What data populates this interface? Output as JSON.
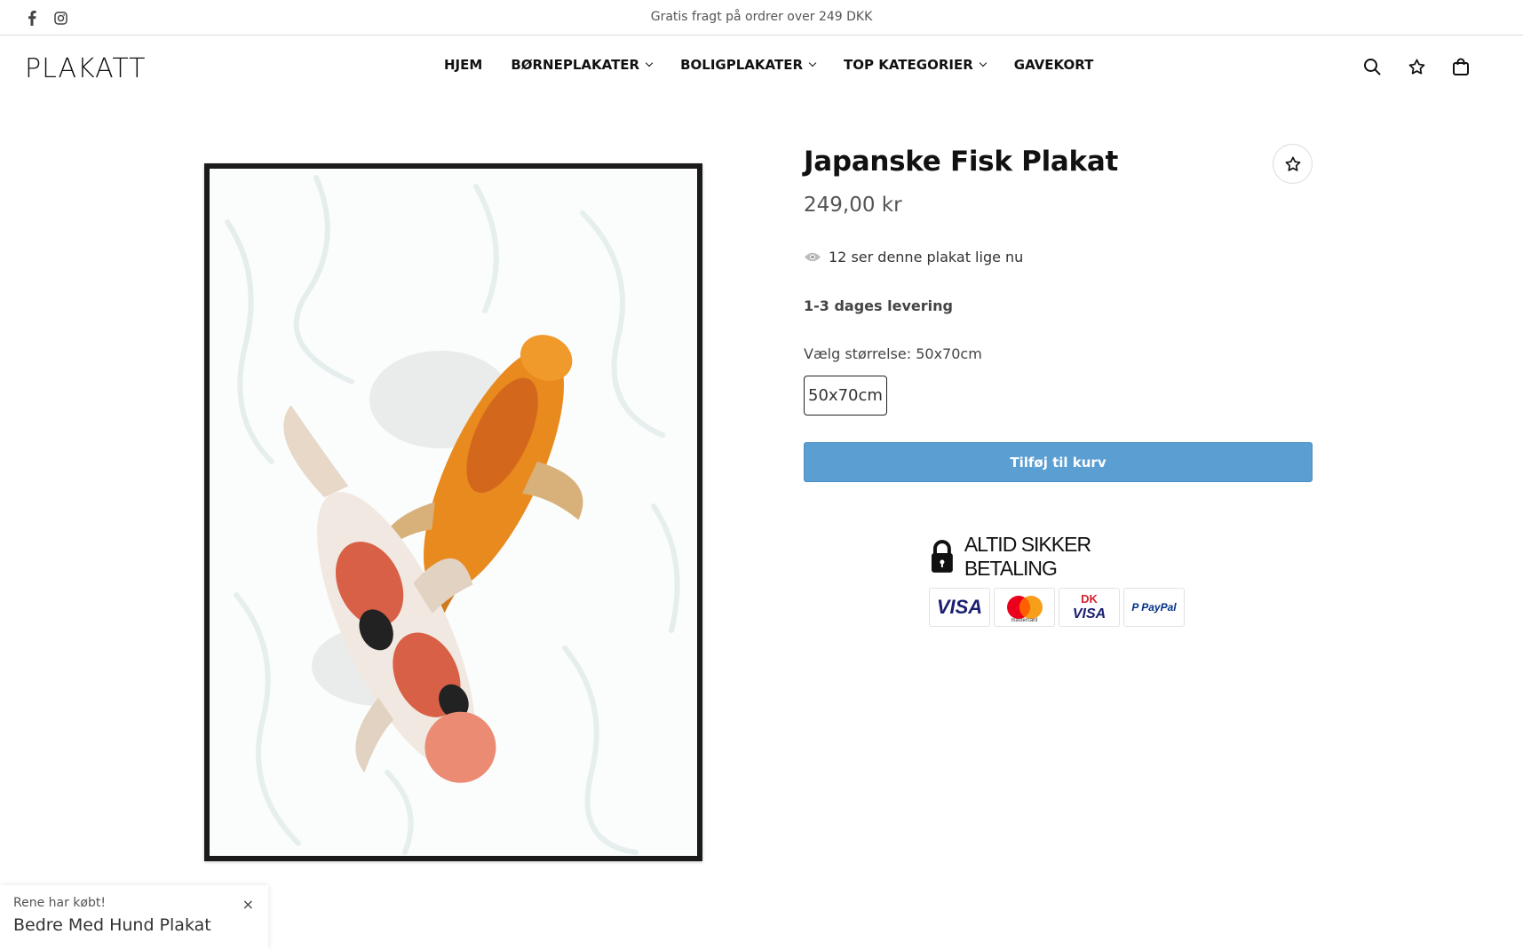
{
  "topbar": {
    "announcement": "Gratis fragt på ordrer over 249 DKK",
    "social_icons": [
      "facebook-icon",
      "instagram-icon"
    ]
  },
  "header": {
    "logo": "PLAKATT",
    "nav": [
      {
        "label": "HJEM",
        "has_dropdown": false
      },
      {
        "label": "BØRNEPLAKATER",
        "has_dropdown": true
      },
      {
        "label": "BOLIGPLAKATER",
        "has_dropdown": true
      },
      {
        "label": "TOP KATEGORIER",
        "has_dropdown": true
      },
      {
        "label": "GAVEKORT",
        "has_dropdown": false
      }
    ],
    "icons": [
      "search-icon",
      "star-icon",
      "bag-icon"
    ]
  },
  "product": {
    "title": "Japanske Fisk Plakat",
    "price": "249,00 kr",
    "viewers": "12 ser denne plakat lige nu",
    "delivery": "1-3 dages levering",
    "size_label": "Vælg størrelse: 50x70cm",
    "size_option": "50x70cm",
    "add_to_cart": "Tilføj til kurv",
    "secure_payment": "ALTID SIKKER BETALING",
    "payment_cards": {
      "visa": "VISA",
      "mastercard": "mastercard",
      "dankort_top": "DK",
      "dankort_bottom": "VISA",
      "paypal_a": "P PayPal"
    }
  },
  "toast": {
    "who": "Rene har købt!",
    "what": "Bedre Med Hund Plakat",
    "close": "×"
  },
  "colors": {
    "accent_button": "#5b9ed2",
    "text": "#111111",
    "muted": "#555555"
  }
}
